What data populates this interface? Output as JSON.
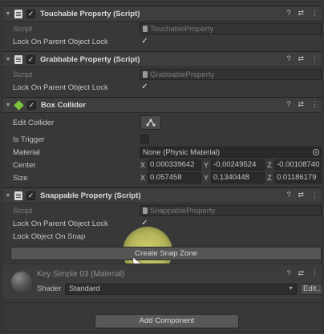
{
  "components": {
    "touchable": {
      "title": "Touchable Property (Script)",
      "script_label": "Script",
      "script_value": "TouchableProperty",
      "lock_label": "Lock On Parent Object Lock",
      "lock_checked": "✓"
    },
    "grabbable": {
      "title": "Grabbable Property (Script)",
      "script_label": "Script",
      "script_value": "GrabbableProperty",
      "lock_label": "Lock On Parent Object Lock",
      "lock_checked": "✓"
    },
    "box_collider": {
      "title": "Box Collider",
      "edit_collider_label": "Edit Collider",
      "is_trigger_label": "Is Trigger",
      "material_label": "Material",
      "material_value": "None (Physic Material)",
      "center_label": "Center",
      "center": {
        "x": "0.000339642",
        "y": "-0.00249524",
        "z": "-0.00108740"
      },
      "size_label": "Size",
      "size": {
        "x": "0.057458",
        "y": "0.1340448",
        "z": "0.01186179"
      },
      "axis_x": "X",
      "axis_y": "Y",
      "axis_z": "Z"
    },
    "snappable": {
      "title": "Snappable Property (Script)",
      "script_label": "Script",
      "script_value": "SnappableProperty",
      "lock_label": "Lock On Parent Object Lock",
      "lock_checked": "✓",
      "lock_snap_label": "Lock Object On Snap",
      "create_snap_zone": "Create Snap Zone"
    }
  },
  "material": {
    "title": "Key Simple 03 (Material)",
    "shader_label": "Shader",
    "shader_value": "Standard",
    "edit_label": "Edit..."
  },
  "add_component": "Add Component",
  "icons": {
    "help": "?",
    "settings": "⇄",
    "more": "⋮",
    "fold": "▼",
    "dropdown": "▼"
  }
}
